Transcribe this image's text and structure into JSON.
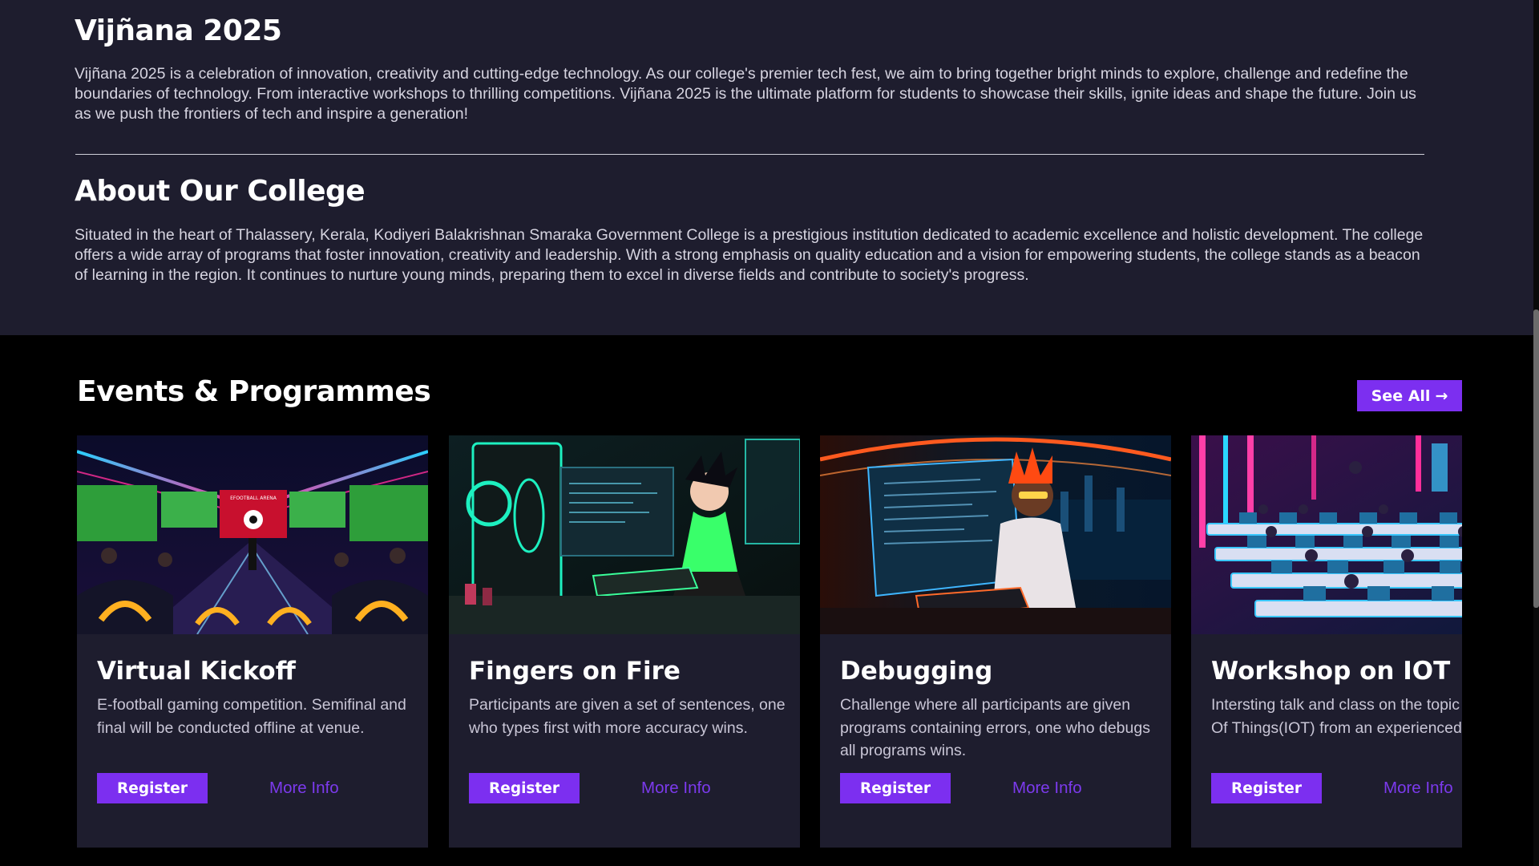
{
  "hero": {
    "title": "Vijñana 2025",
    "description": "Vijñana 2025 is a celebration of innovation, creativity and cutting-edge technology. As our college's premier tech fest, we aim to bring together bright minds to explore, challenge and redefine the boundaries of technology. From interactive workshops to thrilling competitions. Vijñana 2025 is the ultimate platform for students to showcase their skills, ignite ideas and shape the future. Join us as we push the frontiers of tech and inspire a generation!"
  },
  "about": {
    "title": "About Our College",
    "description": "Situated in the heart of Thalassery, Kerala, Kodiyeri Balakrishnan Smaraka Government College is a prestigious institution dedicated to academic excellence and holistic development. The college offers a wide array of programs that foster innovation, creativity and leadership. With a strong emphasis on quality education and a vision for empowering students, the college stands as a beacon of learning in the region. It continues to nurture young minds, preparing them to excel in diverse fields and contribute to society's progress."
  },
  "events": {
    "title": "Events & Programmes",
    "see_all_label": "See All",
    "see_all_icon": "arrow-right-icon",
    "cards": [
      {
        "title": "Virtual Kickoff",
        "description": "E-football gaming competition. Semifinal and final will be conducted offline at venue.",
        "register_label": "Register",
        "more_label": "More Info",
        "image_alt": "esports football arena",
        "arena_sign": "EFOOTBALL ARENA"
      },
      {
        "title": "Fingers on Fire",
        "description": "Participants are given a set of sentences, one who types first with more accuracy wins.",
        "register_label": "Register",
        "more_label": "More Info",
        "image_alt": "woman typing at neon computer"
      },
      {
        "title": "Debugging",
        "description": "Challenge where all participants are given programs containing errors, one who debugs all programs wins.",
        "register_label": "Register",
        "more_label": "More Info",
        "image_alt": "coder at curved monitor"
      },
      {
        "title": "Workshop on IOT",
        "description": "Intersting talk and class on the topic Internet Of Things(IOT) from an experienced mentors.",
        "register_label": "Register",
        "more_label": "More Info",
        "image_alt": "neon classroom with computers"
      }
    ]
  },
  "colors": {
    "accent": "#7c2ff0",
    "link": "#7c3aed",
    "section_bg": "#1e1d2e",
    "page_bg": "#000000"
  }
}
